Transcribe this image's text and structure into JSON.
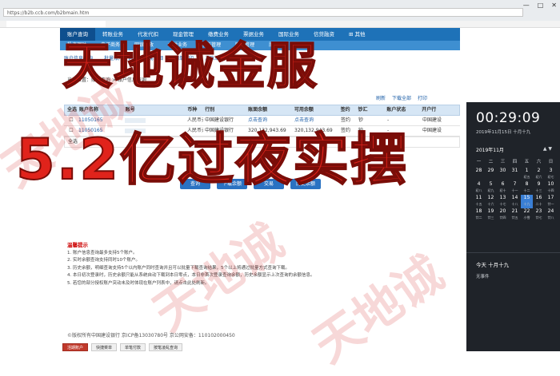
{
  "browser": {
    "address": "https://b2b.ccb.com/b2bmain.htm",
    "tab_title": "",
    "window_buttons": [
      "—",
      "□",
      "✕"
    ]
  },
  "nav_primary": [
    "账户查询",
    "转账业务",
    "代发代扣",
    "现金管理",
    "缴费业务",
    "票据业务",
    "国际业务",
    "信贷融资",
    "⊞ 其他"
  ],
  "nav_secondary": [
    "投资理财",
    "电子商务",
    "网银行政",
    "本类业务",
    "服务管理",
    "财务管理",
    "服务设置"
  ],
  "subtabs": [
    "账户信息查询",
    "批量账户查询",
    "交易明细",
    "回单打印",
    "对账单"
  ],
  "breadcrumb": "当前位置：账户查询 > 账户信息查询",
  "toolbar": [
    "刷新",
    "下载全部",
    "打印"
  ],
  "table": {
    "headers": [
      "全选",
      "账户名称",
      "账号",
      "币种",
      "行别",
      "账面余额",
      "可用余额",
      "签约",
      "钞汇",
      "账户状态",
      "开户行"
    ],
    "rows": [
      [
        "",
        "11050165",
        "",
        "人民币元",
        "中国建设银行",
        "点击查询",
        "点击查询",
        "签约",
        "钞",
        "-",
        "中国建设"
      ],
      [
        "",
        "11050165",
        "",
        "人民币元",
        "中国建设银行",
        "320,132,943.69",
        "320,132,943.69",
        "签约",
        "钞",
        "-",
        "中国建设"
      ]
    ],
    "footer": "全选"
  },
  "buttons": [
    "查询",
    "下载余额",
    "交易",
    "历史余额"
  ],
  "tips": {
    "title": "温馨提示",
    "lines": [
      "1. 账户信息查询最多支持5个账户。",
      "2. 实时余额查询支持同时10个账户。",
      "3. 历史余额，明细查询支持5个以内账户同时查询并且可以批量下载查询结果，5个以上将通过批量方式查询下载。",
      "4. 本日初次登录时，历史余额只能从系统自动下载到本日零点，本日非首次登录查询余额，历史余额显示上次查询的余额信息。",
      "5. 若您的部分授权账户突动未及时体现在账户列表中，请点击此处刷新。"
    ]
  },
  "footer": "©版权所有中国建设银行    京ICP备13030780号    京公网安备：110102000450",
  "bottom_tabs": [
    "活期账户",
    "快捷菜单",
    "单笔付款",
    "按笔凌乱查询"
  ],
  "overlay": {
    "line1": "天地诚金服",
    "line2": "5.2亿过夜实摆",
    "watermark": "天地诚"
  },
  "clock": {
    "time": "00:29:09",
    "date": "2019年11月15日 十月十九",
    "month": "2019年11月",
    "weekdays": [
      "一",
      "二",
      "三",
      "四",
      "五",
      "六",
      "日"
    ],
    "days": [
      {
        "n": "28",
        "l": ""
      },
      {
        "n": "29",
        "l": ""
      },
      {
        "n": "30",
        "l": ""
      },
      {
        "n": "31",
        "l": ""
      },
      {
        "n": "1",
        "l": "初五"
      },
      {
        "n": "2",
        "l": "初六"
      },
      {
        "n": "3",
        "l": "初七"
      },
      {
        "n": "4",
        "l": "初八"
      },
      {
        "n": "5",
        "l": "初九"
      },
      {
        "n": "6",
        "l": "初十"
      },
      {
        "n": "7",
        "l": "十一"
      },
      {
        "n": "8",
        "l": "十二"
      },
      {
        "n": "9",
        "l": "十三"
      },
      {
        "n": "10",
        "l": "十四"
      },
      {
        "n": "11",
        "l": "十五"
      },
      {
        "n": "12",
        "l": "十六"
      },
      {
        "n": "13",
        "l": "十七"
      },
      {
        "n": "14",
        "l": "十八"
      },
      {
        "n": "15",
        "l": "十九"
      },
      {
        "n": "16",
        "l": "二十"
      },
      {
        "n": "17",
        "l": "廿一"
      },
      {
        "n": "18",
        "l": "廿二"
      },
      {
        "n": "19",
        "l": "廿三"
      },
      {
        "n": "20",
        "l": "廿四"
      },
      {
        "n": "21",
        "l": "廿五"
      },
      {
        "n": "22",
        "l": "小雪"
      },
      {
        "n": "23",
        "l": "廿七"
      },
      {
        "n": "24",
        "l": "廿八"
      }
    ],
    "agenda_title": "今天 十月十九",
    "agenda_empty": "无事件",
    "today_accent": "#3a7fd5"
  },
  "colors": {
    "nav": "#1e72b8",
    "overlay": "#e0231b"
  }
}
